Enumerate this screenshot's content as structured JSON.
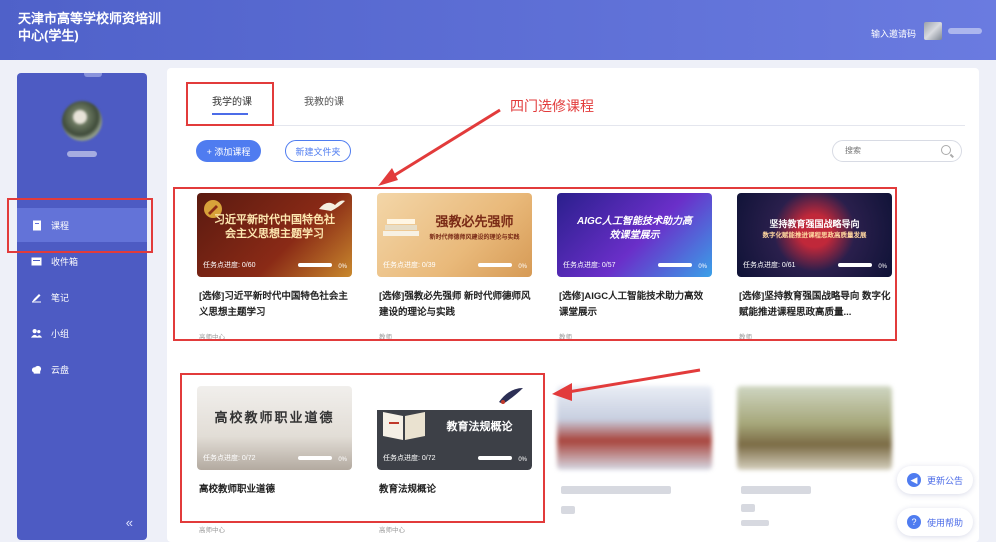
{
  "header": {
    "title": "天津市高等学校师资培训中心(学生)",
    "invite_label": "输入邀请码"
  },
  "sidebar": {
    "items": [
      {
        "label": "课程",
        "icon": "book-icon"
      },
      {
        "label": "收件箱",
        "icon": "inbox-icon"
      },
      {
        "label": "笔记",
        "icon": "note-icon"
      },
      {
        "label": "小组",
        "icon": "group-icon"
      },
      {
        "label": "云盘",
        "icon": "cloud-icon"
      }
    ],
    "collapse_label": "«"
  },
  "tabs": [
    {
      "label": "我学的课"
    },
    {
      "label": "我教的课"
    }
  ],
  "toolbar": {
    "add_course": "+ 添加课程",
    "new_folder": "新建文件夹",
    "search_placeholder": "搜索"
  },
  "annotation": "四门选修课程",
  "courses": [
    {
      "thumb_text": "习近平新时代中国特色社会主义思想主题学习",
      "progress": "任务点进度: 0/60",
      "percent": "0%",
      "title": "[选修]习近平新时代中国特色社会主义思想主题学习",
      "source": "高师中心"
    },
    {
      "thumb_text": "强教必先强师",
      "thumb_sub": "新时代师德师风建设的理论与实践",
      "progress": "任务点进度: 0/39",
      "percent": "0%",
      "title": "[选修]强教必先强师 新时代师德师风建设的理论与实践",
      "source": "教师"
    },
    {
      "thumb_text": "AIGC人工智能技术助力高效课堂展示",
      "progress": "任务点进度: 0/57",
      "percent": "0%",
      "title": "[选修]AIGC人工智能技术助力高效课堂展示",
      "source": "教师"
    },
    {
      "thumb_text": "坚持教育强国战略导向",
      "thumb_sub": "数字化赋能推进课程思政高质量发展",
      "progress": "任务点进度: 0/61",
      "percent": "0%",
      "title": "[选修]坚持教育强国战略导向 数字化赋能推进课程思政高质量...",
      "source": "教师"
    },
    {
      "thumb_text": "高校教师职业道德",
      "progress": "任务点进度: 0/72",
      "percent": "0%",
      "title": "高校教师职业道德",
      "source": "高师中心"
    },
    {
      "thumb_text": "教育法规概论",
      "progress": "任务点进度: 0/72",
      "percent": "0%",
      "title": "教育法规概论",
      "source": "高师中心"
    }
  ],
  "float": {
    "announcement": "更新公告",
    "help": "使用帮助"
  },
  "colors": {
    "primary": "#4f7cf0",
    "sidebar": "#4d5bc3",
    "annotation_red": "#e23b3b"
  }
}
